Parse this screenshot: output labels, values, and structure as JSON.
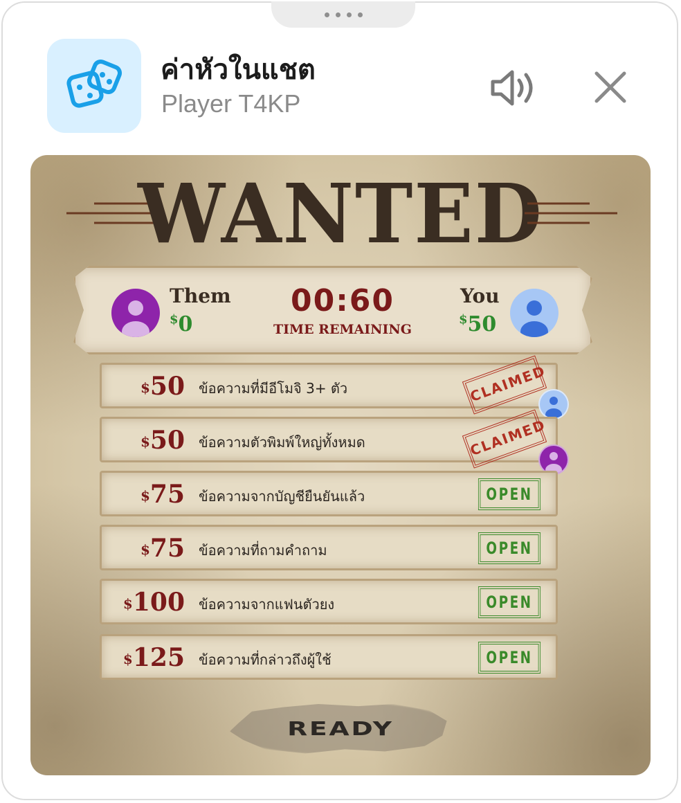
{
  "header": {
    "title": "ค่าหัวในแชต",
    "subtitle": "Player T4KP",
    "icons": {
      "app": "dice-icon",
      "sound": "speaker-icon",
      "close": "close-icon"
    }
  },
  "poster": {
    "title": "WANTED",
    "scoreboard": {
      "them": {
        "name": "Them",
        "amount": "0",
        "currency": "$"
      },
      "you": {
        "name": "You",
        "amount": "50",
        "currency": "$"
      },
      "timer": "00:60",
      "timer_label": "TIME REMAINING"
    },
    "bounties": [
      {
        "amount": "50",
        "text": "ข้อความที่มีอีโมจิ 3+ ตัว",
        "status": "CLAIMED",
        "claimed_by": "you"
      },
      {
        "amount": "50",
        "text": "ข้อความตัวพิมพ์ใหญ่ทั้งหมด",
        "status": "CLAIMED",
        "claimed_by": "them"
      },
      {
        "amount": "75",
        "text": "ข้อความจากบัญชียืนยันแล้ว",
        "status": "OPEN"
      },
      {
        "amount": "75",
        "text": "ข้อความที่ถามคำถาม",
        "status": "OPEN"
      },
      {
        "amount": "100",
        "text": "ข้อความจากแฟนตัวยง",
        "status": "OPEN"
      },
      {
        "amount": "125",
        "text": "ข้อความที่กล่าวถึงผู้ใช้",
        "status": "OPEN"
      }
    ],
    "ready_label": "READY"
  },
  "colors": {
    "open": "#3a8a2a",
    "claimed": "#b03022",
    "amount": "#7a1a1a",
    "money": "#2e8b2e",
    "them": "#8e24aa",
    "you": "#a7c7f5"
  }
}
